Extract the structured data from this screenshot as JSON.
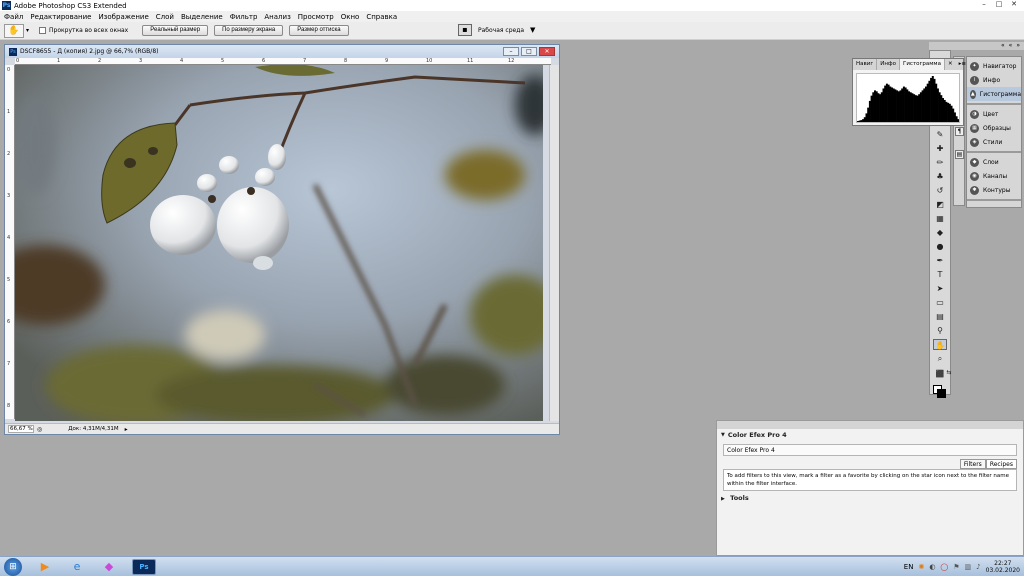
{
  "app": {
    "title": "Adobe Photoshop CS3 Extended",
    "logo_text": "Ps",
    "window_controls": [
      "–",
      "□",
      "✕"
    ]
  },
  "menu": [
    "Файл",
    "Редактирование",
    "Изображение",
    "Слой",
    "Выделение",
    "Фильтр",
    "Анализ",
    "Просмотр",
    "Окно",
    "Справка"
  ],
  "options_bar": {
    "tool_icon": "hand-icon",
    "scroll_all_label": "Прокрутка во всех окнах",
    "buttons": [
      "Реальный размер",
      "По размеру экрана",
      "Размер оттиска"
    ],
    "workspace_label": "Рабочая среда"
  },
  "document": {
    "title": "DSCF8655 - Д (копия) 2.jpg @ 66,7% (RGB/8)",
    "zoom": "66,67 %",
    "doc_size": "Док: 4,31M/4,31M",
    "ruler_top": [
      "0",
      "1",
      "2",
      "3",
      "4",
      "5",
      "6",
      "7",
      "8",
      "9",
      "10",
      "11",
      "12"
    ],
    "ruler_left": [
      "0",
      "1",
      "2",
      "3",
      "4",
      "5",
      "6",
      "7",
      "8"
    ]
  },
  "histogram_panel": {
    "tabs": [
      "Навиг",
      "Инфо",
      "Гистограмма"
    ],
    "active_tab": "Гистограмма",
    "close": "✕",
    "levels": [
      2,
      3,
      4,
      6,
      10,
      18,
      30,
      44,
      55,
      62,
      66,
      64,
      60,
      58,
      62,
      70,
      76,
      80,
      78,
      74,
      72,
      70,
      68,
      66,
      64,
      66,
      70,
      74,
      72,
      68,
      64,
      62,
      60,
      58,
      56,
      55,
      58,
      62,
      66,
      70,
      74,
      80,
      86,
      92,
      96,
      90,
      80,
      70,
      62,
      56,
      50,
      46,
      42,
      40,
      38,
      34,
      28,
      20,
      12,
      6
    ]
  },
  "dock_panels": [
    {
      "items": [
        {
          "label": "Навигатор",
          "icon": "navigator-icon"
        },
        {
          "label": "Инфо",
          "icon": "info-icon"
        },
        {
          "label": "Гистограмма",
          "icon": "histogram-icon",
          "selected": true
        }
      ]
    },
    {
      "items": [
        {
          "label": "Цвет",
          "icon": "color-icon"
        },
        {
          "label": "Образцы",
          "icon": "swatches-icon"
        },
        {
          "label": "Стили",
          "icon": "styles-icon"
        }
      ]
    },
    {
      "items": [
        {
          "label": "Слои",
          "icon": "layers-icon"
        },
        {
          "label": "Каналы",
          "icon": "channels-icon"
        },
        {
          "label": "Контуры",
          "icon": "paths-icon"
        }
      ]
    }
  ],
  "efex_panel": {
    "header": "Color Efex Pro 4",
    "field": "Color Efex Pro 4",
    "tabs": [
      "Filters",
      "Recipes"
    ],
    "active_tab": "Filters",
    "message": "To add filters to this view, mark a filter as a favorite by clicking on the star icon next to the filter name within the filter interface.",
    "tools_label": "Tools"
  },
  "taskbar": {
    "apps": [
      {
        "name": "media-player-icon",
        "glyph": "▶"
      },
      {
        "name": "internet-explorer-icon",
        "glyph": "e"
      },
      {
        "name": "app-icon",
        "glyph": "◆"
      },
      {
        "name": "photoshop-taskbar-icon",
        "glyph": "Ps",
        "active": true
      }
    ],
    "lang": "EN",
    "time": "22:27",
    "date": "03.02.2020"
  },
  "colors": {
    "workspace_bg": "#a9a9a9",
    "doc_border": "#6e87a6",
    "selected_item": "#b9c9dd",
    "close_red": "#d94848"
  }
}
